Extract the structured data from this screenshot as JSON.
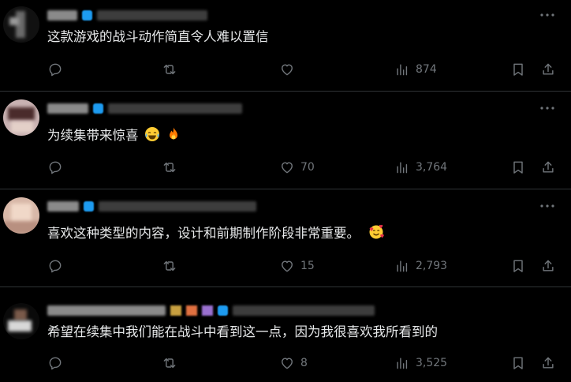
{
  "replies": [
    {
      "text": "这款游戏的战斗动作简直令人难以置信",
      "reply_count": "",
      "retweet_count": "",
      "like_count": "",
      "view_count": "874"
    },
    {
      "text": "为续集带来惊喜",
      "emojis": [
        "face-with-tears-of-joy",
        "fire"
      ],
      "reply_count": "",
      "retweet_count": "",
      "like_count": "70",
      "view_count": "3,764"
    },
    {
      "text": "喜欢这种类型的内容，设计和前期制作阶段非常重要。",
      "emojis": [
        "smiling-face-with-hearts"
      ],
      "reply_count": "",
      "retweet_count": "",
      "like_count": "15",
      "view_count": "2,793"
    },
    {
      "text": "希望在续集中我们能在战斗中看到这一点，因为我很喜欢我所看到的",
      "reply_count": "",
      "retweet_count": "",
      "like_count": "8",
      "view_count": "3,525"
    }
  ],
  "colors": {
    "background": "#000000",
    "text": "#e7e9ea",
    "muted": "#71767b",
    "divider": "#2f3336",
    "verified": "#1d9bf0"
  },
  "icons": [
    "more-icon",
    "reply-icon",
    "retweet-icon",
    "like-icon",
    "views-icon",
    "bookmark-icon",
    "share-icon"
  ]
}
